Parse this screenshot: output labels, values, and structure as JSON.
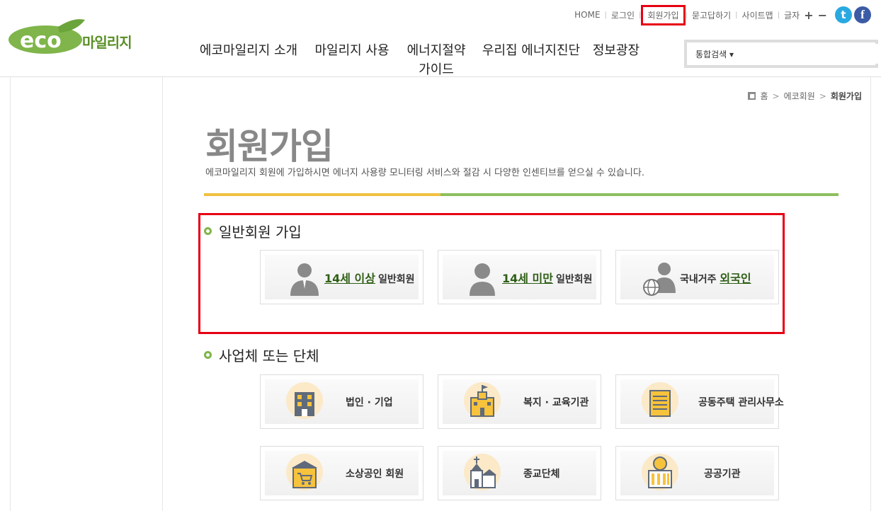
{
  "header": {
    "logo_text": "마일리지",
    "util_links": [
      "HOME",
      "로그인",
      "회원가입",
      "묻고답하기",
      "사이트맵"
    ],
    "font_size_label": "글자",
    "font_plus": "+",
    "font_minus": "−",
    "twitter": "t",
    "facebook": "f"
  },
  "gnb": [
    "에코마일리지 소개",
    "마일리지 사용",
    "에너지절약 가이드",
    "우리집 에너지진단",
    "정보광장"
  ],
  "search": {
    "scope": "통합검색",
    "placeholder": ""
  },
  "breadcrumb": {
    "home": "홈",
    "level1": "에코회원",
    "current": "회원가입"
  },
  "page": {
    "title": "회원가입",
    "desc": "에코마일리지 회원에 가입하시면 에너지 사용량 모니터링 서비스와 절감 시 다양한 인센티브를 얻으실 수 있습니다."
  },
  "sections": {
    "general": {
      "title": "일반회원 가입",
      "cards": [
        {
          "em": "14세 이상",
          "rest": "일반회원",
          "icon": "adult-user-icon"
        },
        {
          "em": "14세 미만",
          "rest": "일반회원",
          "icon": "child-user-icon"
        },
        {
          "pre": "국내거주",
          "em": "외국인",
          "icon": "foreigner-globe-icon"
        }
      ]
    },
    "business": {
      "title": "사업체 또는 단체",
      "cards": [
        {
          "label": "법인 · 기업",
          "icon": "office-building-icon"
        },
        {
          "label": "복지 · 교육기관",
          "icon": "school-building-icon"
        },
        {
          "label": "공동주택 관리사무소",
          "icon": "apartment-office-icon"
        },
        {
          "label": "소상공인 회원",
          "icon": "shop-cart-icon"
        },
        {
          "label": "종교단체",
          "icon": "church-icon"
        },
        {
          "label": "공공기관",
          "icon": "public-institution-icon"
        }
      ]
    }
  },
  "colors": {
    "accent_green": "#7fb54a",
    "highlight_red": "#e60012",
    "bar_yellow": "#f0c040",
    "bar_green": "#8dbf5e"
  }
}
